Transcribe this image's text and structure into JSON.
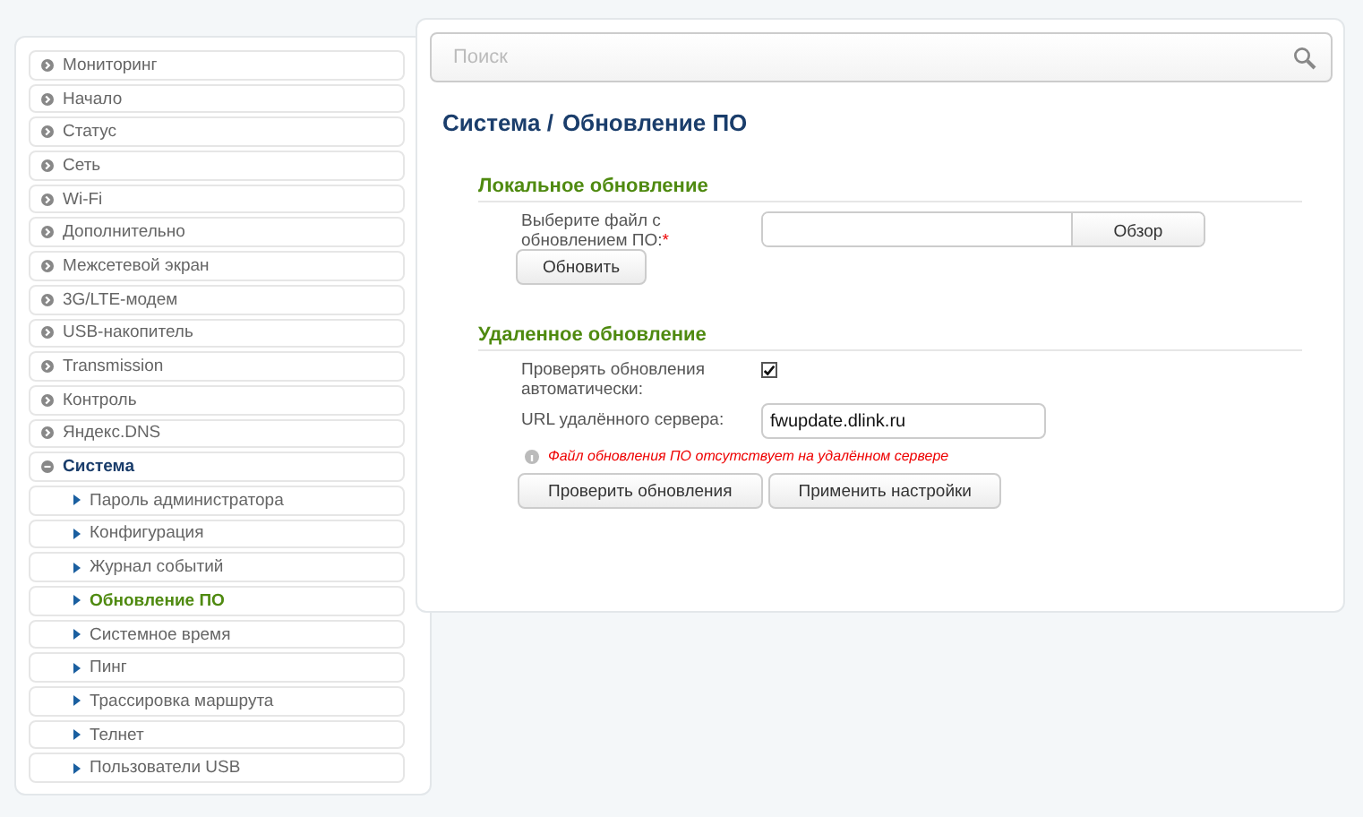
{
  "sidebar": {
    "items": [
      {
        "label": "Мониторинг",
        "expanded": false,
        "selected": false
      },
      {
        "label": "Начало",
        "expanded": false,
        "selected": false
      },
      {
        "label": "Статус",
        "expanded": false,
        "selected": false
      },
      {
        "label": "Сеть",
        "expanded": false,
        "selected": false
      },
      {
        "label": "Wi-Fi",
        "expanded": false,
        "selected": false
      },
      {
        "label": "Дополнительно",
        "expanded": false,
        "selected": false
      },
      {
        "label": "Межсетевой экран",
        "expanded": false,
        "selected": false
      },
      {
        "label": "3G/LTE-модем",
        "expanded": false,
        "selected": false
      },
      {
        "label": "USB-накопитель",
        "expanded": false,
        "selected": false
      },
      {
        "label": "Transmission",
        "expanded": false,
        "selected": false
      },
      {
        "label": "Контроль",
        "expanded": false,
        "selected": false
      },
      {
        "label": "Яндекс.DNS",
        "expanded": false,
        "selected": false
      },
      {
        "label": "Система",
        "expanded": true,
        "selected": false,
        "children": [
          {
            "label": "Пароль администратора",
            "selected": false
          },
          {
            "label": "Конфигурация",
            "selected": false
          },
          {
            "label": "Журнал событий",
            "selected": false
          },
          {
            "label": "Обновление ПО",
            "selected": true
          },
          {
            "label": "Системное время",
            "selected": false
          },
          {
            "label": "Пинг",
            "selected": false
          },
          {
            "label": "Трассировка маршрута",
            "selected": false
          },
          {
            "label": "Телнет",
            "selected": false
          },
          {
            "label": "Пользователи USB",
            "selected": false
          }
        ]
      }
    ]
  },
  "search": {
    "placeholder": "Поиск"
  },
  "breadcrumb": [
    "Система /",
    "Обновление ПО"
  ],
  "local_update": {
    "title": "Локальное обновление",
    "file_label": "Выберите файл с обновлением ПО:",
    "required_mark": "*",
    "browse_button": "Обзор",
    "update_button": "Обновить"
  },
  "remote_update": {
    "title": "Удаленное обновление",
    "auto_check_label": "Проверять обновления автоматически:",
    "auto_check": true,
    "url_label": "URL удалённого сервера:",
    "url_value": "fwupdate.dlink.ru",
    "message": "Файл обновления ПО отсутствует на удалённом сервере",
    "buttons": [
      "Проверить обновления",
      "Применить настройки"
    ]
  }
}
